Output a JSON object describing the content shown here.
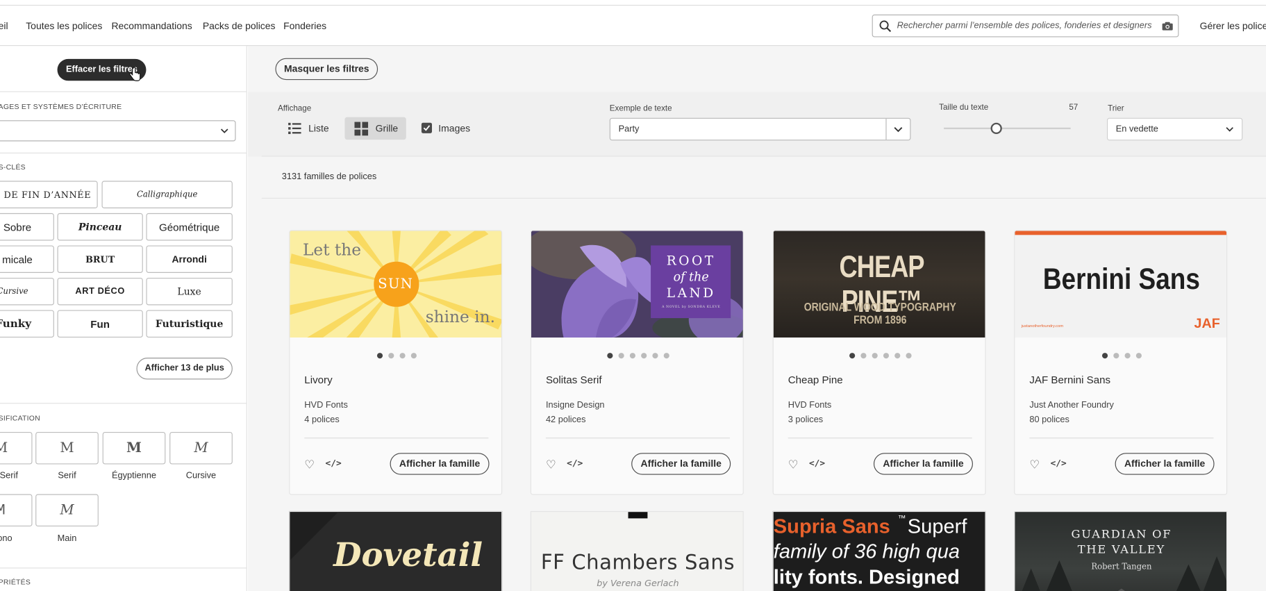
{
  "nav": {
    "items": [
      "eil",
      "Toutes les polices",
      "Recommandations",
      "Packs de polices",
      "Fonderies"
    ],
    "search_placeholder": "Rechercher parmi l’ensemble des polices, fonderies et designers",
    "manage": "Gérer les polices"
  },
  "sidebar": {
    "clear_filters": "Effacer les filtres",
    "languages_label": "AGES ET SYSTÈMES D’ÉCRITURE",
    "tags_label": "S-CLÉS",
    "tags": [
      "ES DE FIN D’ANNÉE",
      "Calligraphique",
      "Sobre",
      "Pinceau",
      "Géométrique",
      "micale",
      "BRUT",
      "Arrondi",
      "Cursive",
      "ART DÉCO",
      "Luxe",
      "Funky",
      "Fun",
      "Futuristique"
    ],
    "show_more": "Afficher 13 de plus",
    "classification_label": "SIFICATION",
    "classifications": [
      {
        "glyph": "M",
        "label": "Serif"
      },
      {
        "glyph": "M",
        "label": "Serif"
      },
      {
        "glyph": "M",
        "label": "Égyptienne"
      },
      {
        "glyph": "M",
        "label": "Cursive"
      },
      {
        "glyph": "M",
        "label": "ono"
      },
      {
        "glyph": "M",
        "label": "Main"
      }
    ],
    "properties_label": "PRIÉTÉS"
  },
  "toolbar": {
    "hide_filters": "Masquer les filtres",
    "display_label": "Affichage",
    "list_label": "Liste",
    "grid_label": "Grille",
    "images_label": "Images",
    "images_checked": true,
    "sample_label": "Exemple de texte",
    "sample_value": "Party",
    "size_label": "Taille du texte",
    "size_value": "57",
    "sort_label": "Trier",
    "sort_value": "En vedette"
  },
  "results": {
    "count": "3131 familles de polices"
  },
  "cards": [
    {
      "name": "Livory",
      "foundry": "HVD Fonts",
      "count": "4 polices",
      "dots": 4,
      "img_lines": [
        "Let the",
        "SUN",
        "shine in."
      ]
    },
    {
      "name": "Solitas Serif",
      "foundry": "Insigne Design",
      "count": "42 polices",
      "dots": 6,
      "img_lines": [
        "ROOT",
        "of the",
        "LAND",
        "A NOVEL by SONDRA KLEVE"
      ]
    },
    {
      "name": "Cheap Pine",
      "foundry": "HVD Fonts",
      "count": "3 polices",
      "dots": 6,
      "img_lines": [
        "CHEAP PINE™",
        "ORIGINAL WOOD TYPOGRAPHY FROM 1896"
      ]
    },
    {
      "name": "JAF Bernini Sans",
      "foundry": "Just Another Foundry",
      "count": "80 polices",
      "dots": 4,
      "img_lines": [
        "Bernini Sans",
        "justanotherfoundry.com",
        "JAF"
      ]
    }
  ],
  "card_button": "Afficher la famille",
  "row2": [
    {
      "img_lines": [
        "Dovetail"
      ]
    },
    {
      "img_lines": [
        "FF Chambers Sans",
        "by Verena Gerlach"
      ]
    },
    {
      "img_lines": [
        "Supria Sans",
        "™",
        "Superf",
        "family of 36 high qua",
        "lity fonts. Designed"
      ]
    },
    {
      "img_lines": [
        "GUARDIAN OF",
        "THE VALLEY",
        "Robert Tangen"
      ]
    }
  ],
  "colors": {
    "dark": "#2c2c2c",
    "sun": "#f7a21b",
    "purple": "#5e3d8c",
    "orange": "#e8612c"
  }
}
